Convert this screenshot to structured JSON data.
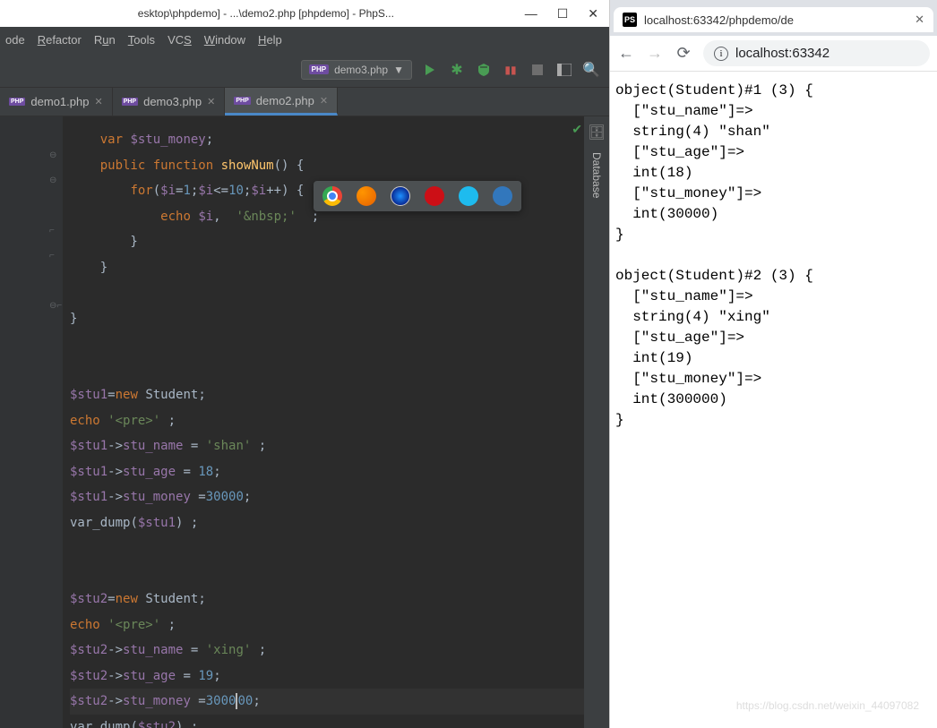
{
  "ide": {
    "title": "esktop\\phpdemo] - ...\\demo2.php [phpdemo] - PhpS...",
    "window_controls": {
      "min": "—",
      "max": "☐",
      "close": "✕"
    },
    "menu": [
      "ode",
      "Refactor",
      "Run",
      "Tools",
      "VCS",
      "Window",
      "Help"
    ],
    "run_config": {
      "label": "demo3.php",
      "dropdown": "▼"
    },
    "toolbar_icons": [
      "run",
      "debug",
      "coverage",
      "stop-red",
      "stop-gray",
      "layout",
      "search"
    ],
    "tabs": [
      {
        "label": "demo1.php",
        "active": false
      },
      {
        "label": "demo3.php",
        "active": false
      },
      {
        "label": "demo2.php",
        "active": true
      }
    ],
    "sidebar_tool": "Database",
    "browser_popup_icons": [
      "chrome",
      "firefox",
      "safari",
      "opera",
      "ie",
      "edge"
    ],
    "code_tokens": {
      "var_kw": "var",
      "public_kw": "public",
      "function_kw": "function",
      "for_kw": "for",
      "echo_kw": "echo",
      "new_kw": "new",
      "stu_money": "$stu_money",
      "showNum": "showNum",
      "i": "$i",
      "one": "1",
      "ten": "10",
      "nbsp": "'&nbsp;'",
      "stu1": "$stu1",
      "stu2": "$stu2",
      "Student": "Student",
      "pre": "'<pre>'",
      "stu_name": "stu_name",
      "stu_age": "stu_age",
      "stu_money_p": "stu_money",
      "shan": "'shan'",
      "xing": "'xing'",
      "n18": "18",
      "n19": "19",
      "n30000": "30000",
      "n300000": "300000",
      "var_dump": "var_dump"
    }
  },
  "browser": {
    "tab_title": "localhost:63342/phpdemo/de",
    "favicon": "PS",
    "close": "✕",
    "nav": {
      "back": "←",
      "forward": "→",
      "reload": "⟳"
    },
    "url": "localhost:63342",
    "output": "object(Student)#1 (3) {\n  [\"stu_name\"]=>\n  string(4) \"shan\"\n  [\"stu_age\"]=>\n  int(18)\n  [\"stu_money\"]=>\n  int(30000)\n}\n\nobject(Student)#2 (3) {\n  [\"stu_name\"]=>\n  string(4) \"xing\"\n  [\"stu_age\"]=>\n  int(19)\n  [\"stu_money\"]=>\n  int(300000)\n}",
    "watermark": "https://blog.csdn.net/weixin_44097082"
  }
}
